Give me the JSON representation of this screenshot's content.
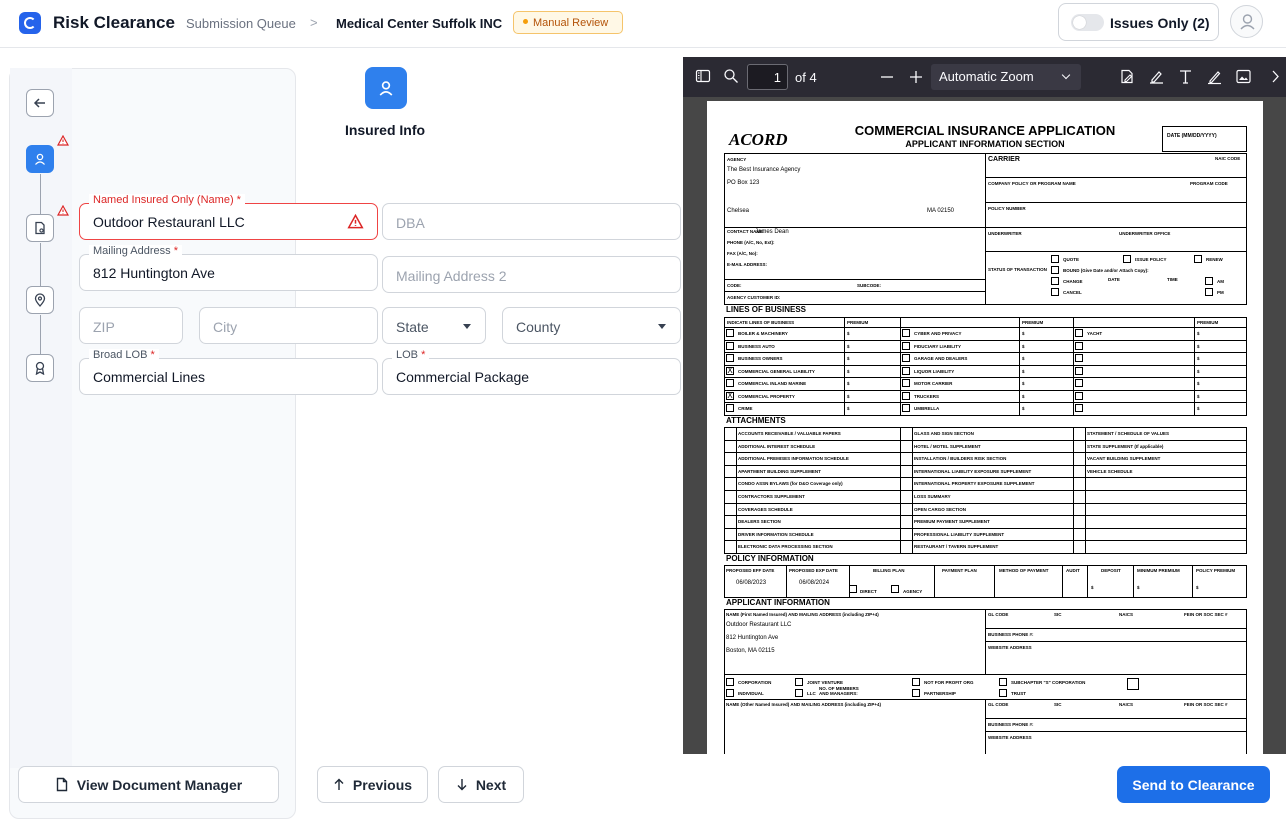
{
  "header": {
    "app_title": "Risk Clearance",
    "breadcrumb_parent": "Submission Queue",
    "breadcrumb_separator": ">",
    "breadcrumb_current": "Medical Center Suffolk INC",
    "status_badge": "Manual Review",
    "issues_toggle_label": "Issues Only (2)"
  },
  "stepper": {
    "steps": [
      {
        "name": "back",
        "icon": "arrow-left-icon"
      },
      {
        "name": "insured-info",
        "icon": "user-icon",
        "active": true,
        "warning": true
      },
      {
        "name": "documents",
        "icon": "document-icon",
        "warning": true
      },
      {
        "name": "location",
        "icon": "location-pin-icon"
      },
      {
        "name": "award",
        "icon": "award-icon"
      }
    ]
  },
  "form": {
    "section_title": "Insured Info",
    "named_insured": {
      "label": "Named Insured Only (Name)",
      "value": "Outdoor Restauranl LLC",
      "required": "*"
    },
    "dba": {
      "placeholder": "DBA"
    },
    "mailing_address": {
      "label": "Mailing Address",
      "value": "812 Huntington Ave",
      "required": "*"
    },
    "mailing_address2": {
      "placeholder": "Mailing Address 2"
    },
    "zip": {
      "placeholder": "ZIP"
    },
    "city": {
      "placeholder": "City"
    },
    "state": {
      "placeholder": "State"
    },
    "county": {
      "placeholder": "County"
    },
    "broad_lob": {
      "label": "Broad LOB",
      "value": "Commercial Lines",
      "required": "*"
    },
    "lob": {
      "label": "LOB",
      "value": "Commercial Package",
      "required": "*"
    }
  },
  "footer": {
    "document_manager": "View Document Manager",
    "previous": "Previous",
    "next": "Next",
    "send": "Send to Clearance"
  },
  "pdf_viewer": {
    "page_number": "1",
    "page_count": "of 4",
    "zoom": "Automatic Zoom"
  },
  "pdf_page": {
    "logo": "ACORD",
    "title": "COMMERCIAL INSURANCE APPLICATION",
    "subtitle": "APPLICANT INFORMATION SECTION",
    "date_label": "DATE (MM/DD/YYYY)",
    "agency_label": "AGENCY",
    "agency_name": "The Best Insurance Agency",
    "agency_address": "PO Box 123",
    "agency_city": "Chelsea",
    "agency_state_zip": "MA  02150",
    "carrier_label": "CARRIER",
    "naic_code_label": "NAIC CODE",
    "company_policy_label": "COMPANY POLICY OR PROGRAM NAME",
    "program_code_label": "PROGRAM CODE",
    "policy_number_label": "POLICY NUMBER",
    "contact_label": "CONTACT NAME:",
    "contact_name": "James Dean",
    "phone_label": "PHONE (A/C, No, Ext):",
    "fax_label": "FAX (A/C, No):",
    "email_label": "E-MAIL ADDRESS:",
    "code_label": "CODE:",
    "subcode_label": "SUBCODE:",
    "agency_customer_label": "AGENCY CUSTOMER ID:",
    "underwriter_label": "UNDERWRITER",
    "underwriter_office_label": "UNDERWRITER OFFICE",
    "status_label": "STATUS OF TRANSACTION",
    "quote": "QUOTE",
    "issue_policy": "ISSUE POLICY",
    "renew": "RENEW",
    "bound": "BOUND (Give Date and/or Attach Copy):",
    "change": "CHANGE",
    "cancel": "CANCEL",
    "date": "DATE",
    "time": "TIME",
    "am": "AM",
    "pm": "PM",
    "lines_title": "LINES OF BUSINESS",
    "indicate_label": "INDICATE LINES OF BUSINESS",
    "premium_label": "PREMIUM",
    "lines_col1": [
      {
        "label": "BOILER & MACHINERY",
        "checked": ""
      },
      {
        "label": "BUSINESS AUTO",
        "checked": ""
      },
      {
        "label": "BUSINESS OWNERS",
        "checked": ""
      },
      {
        "label": "COMMERCIAL GENERAL LIABILITY",
        "checked": "X"
      },
      {
        "label": "COMMERCIAL INLAND MARINE",
        "checked": ""
      },
      {
        "label": "COMMERCIAL PROPERTY",
        "checked": "X"
      },
      {
        "label": "CRIME",
        "checked": ""
      }
    ],
    "lines_col2": [
      "CYBER AND PRIVACY",
      "FIDUCIARY LIABILITY",
      "GARAGE AND DEALERS",
      "LIQUOR LIABILITY",
      "MOTOR CARRIER",
      "TRUCKERS",
      "UMBRELLA"
    ],
    "lines_col3": [
      "YACHT",
      "",
      "",
      "",
      "",
      "",
      ""
    ],
    "dollar": "$",
    "attachments_title": "ATTACHMENTS",
    "attach_col1": [
      "ACCOUNTS RECEIVABLE / VALUABLE PAPERS",
      "ADDITIONAL INTEREST SCHEDULE",
      "ADDITIONAL PREMISES INFORMATION SCHEDULE",
      "APARTMENT BUILDING SUPPLEMENT",
      "CONDO ASSN BYLAWS (for D&O Coverage only)",
      "CONTRACTORS SUPPLEMENT",
      "COVERAGES SCHEDULE",
      "DEALERS SECTION",
      "DRIVER INFORMATION SCHEDULE",
      "ELECTRONIC DATA PROCESSING SECTION"
    ],
    "attach_col2": [
      "GLASS AND SIGN SECTION",
      "HOTEL / MOTEL SUPPLEMENT",
      "INSTALLATION / BUILDERS RISK SECTION",
      "INTERNATIONAL LIABILITY EXPOSURE SUPPLEMENT",
      "INTERNATIONAL PROPERTY EXPOSURE SUPPLEMENT",
      "LOSS SUMMARY",
      "OPEN CARGO SECTION",
      "PREMIUM PAYMENT SUPPLEMENT",
      "PROFESSIONAL LIABILITY SUPPLEMENT",
      "RESTAURANT / TAVERN SUPPLEMENT"
    ],
    "attach_col3": [
      "STATEMENT / SCHEDULE OF VALUES",
      "STATE SUPPLEMENT (If applicable)",
      "VACANT BUILDING SUPPLEMENT",
      "VEHICLE SCHEDULE",
      "",
      "",
      "",
      "",
      "",
      ""
    ],
    "policy_title": "POLICY INFORMATION",
    "proposed_eff_label": "PROPOSED EFF DATE",
    "proposed_exp_label": "PROPOSED EXP DATE",
    "billing_plan_label": "BILLING PLAN",
    "payment_plan_label": "PAYMENT PLAN",
    "method_label": "METHOD OF PAYMENT",
    "audit_label": "AUDIT",
    "deposit_label": "DEPOSIT",
    "min_premium_label": "MINIMUM PREMIUM",
    "policy_premium_label": "POLICY PREMIUM",
    "eff_date": "06/08/2023",
    "exp_date": "06/08/2024",
    "direct": "DIRECT",
    "agency": "AGENCY",
    "applicant_title": "APPLICANT INFORMATION",
    "applicant_name_label": "NAME (First Named Insured) AND MAILING ADDRESS (including ZIP+4)",
    "applicant_name": "Outdoor Restaurant LLC",
    "applicant_street": "812 Huntington Ave",
    "applicant_city": "Boston, MA 02115",
    "gl_code_label": "GL CODE",
    "sic_label": "SIC",
    "naics_label": "NAICS",
    "fein_label": "FEIN OR SOC SEC #",
    "business_phone_label": "BUSINESS PHONE #:",
    "website_label": "WEBSITE ADDRESS",
    "corporation": "CORPORATION",
    "joint_venture": "JOINT VENTURE",
    "not_for_profit": "NOT FOR PROFIT ORG",
    "subchapter_s": "SUBCHAPTER \"S\" CORPORATION",
    "individual": "INDIVIDUAL",
    "llc": "LLC",
    "members_managers": "NO. OF MEMBERS AND MANAGERS:",
    "partnership": "PARTNERSHIP",
    "trust": "TRUST",
    "other_named_label": "NAME (Other Named Insured) AND MAILING ADDRESS (including ZIP+4)"
  }
}
